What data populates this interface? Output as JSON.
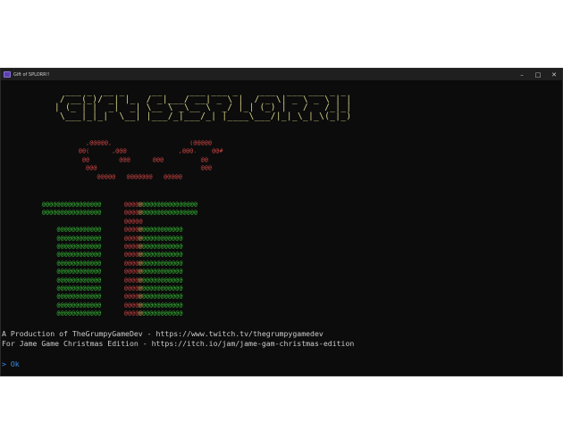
{
  "window": {
    "title": "Gift of SPLORR!!",
    "controls": {
      "minimize": "–",
      "maximize": "□",
      "close": "✕"
    }
  },
  "console": {
    "banner": "░▒▓ GIFT OF SPLORR!! ▓▒░",
    "banner_art": "  ___ _  __ _     __     ___ ___ _    ___  ___ ___ _ _ \n / __(_)/ _| |_  / _|___/ __| _ \\ |  / _ \\| _ \\ _ \\ | |\n| (_ | |  _|  _| \\__ \\ _\\__ \\  _/ |_| (_) |   /   /_|_|\n \\___|_|_|  \\__| |___/_|___/_| |____\\___/|_|_\\_|_\\(_|_)",
    "bow_art": "        ,@@@@@,                     (@@@@@\n      @@(      ,@@@              ,@@@.    @@#\n       @@        @@@      @@@          @@\n        @@@                            @@@\n           @@@@@   @@@@@@@   @@@@@",
    "ribbon_art": "@@@@@\n@@@@@\n@@@@@\n@@@@@\n@@@@@\n@@@@@\n@@@@@\n@@@@@\n@@@@@\n@@@@@\n@@@@@\n@@@@@\n@@@@@\n@@@@@",
    "box_art": "@@@@@@@@@@@@@@@@          @@@@@@@@@@@@@@@@\n@@@@@@@@@@@@@@@@          @@@@@@@@@@@@@@@@\n\n    @@@@@@@@@@@@          @@@@@@@@@@@@\n    @@@@@@@@@@@@          @@@@@@@@@@@@\n    @@@@@@@@@@@@          @@@@@@@@@@@@\n    @@@@@@@@@@@@          @@@@@@@@@@@@\n    @@@@@@@@@@@@          @@@@@@@@@@@@\n    @@@@@@@@@@@@          @@@@@@@@@@@@\n    @@@@@@@@@@@@          @@@@@@@@@@@@\n    @@@@@@@@@@@@          @@@@@@@@@@@@\n    @@@@@@@@@@@@          @@@@@@@@@@@@\n    @@@@@@@@@@@@          @@@@@@@@@@@@\n    @@@@@@@@@@@@          @@@@@@@@@@@@",
    "line1": "A Production of TheGrumpyGameDev - https://www.twitch.tv/thegrumpygamedev",
    "line2": "For Jame Game Christmas Edition - https://itch.io/jam/jame-gam-christmas-edition",
    "prompt": "> Ok"
  },
  "colors": {
    "banner": "#d6d68a",
    "bow": "#d84848",
    "box": "#38c738",
    "text": "#cccccc",
    "prompt": "#3b8eea",
    "background": "#0c0c0c"
  }
}
